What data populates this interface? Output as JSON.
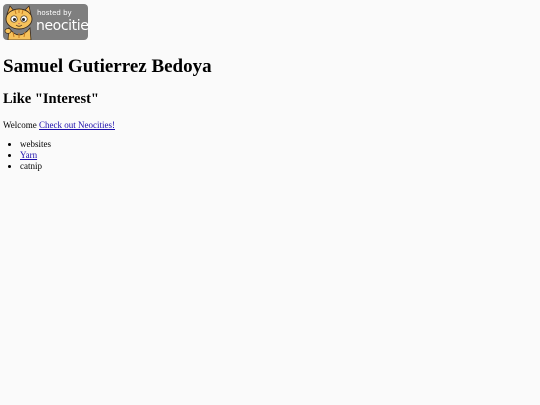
{
  "badge": {
    "hosted_label": "hosted by",
    "brand_label": "neocities",
    "background": "#7f7f7f",
    "icon": "neocities-cat-icon"
  },
  "page": {
    "title": "Samuel Gutierrez Bedoya",
    "subtitle": "Like \"Interest\"",
    "welcome_text": "Welcome",
    "welcome_link": "Check out Neocities!",
    "link_color": "#1a0dab"
  },
  "list": {
    "items": [
      "websites",
      "Yarn",
      "catnip"
    ]
  }
}
